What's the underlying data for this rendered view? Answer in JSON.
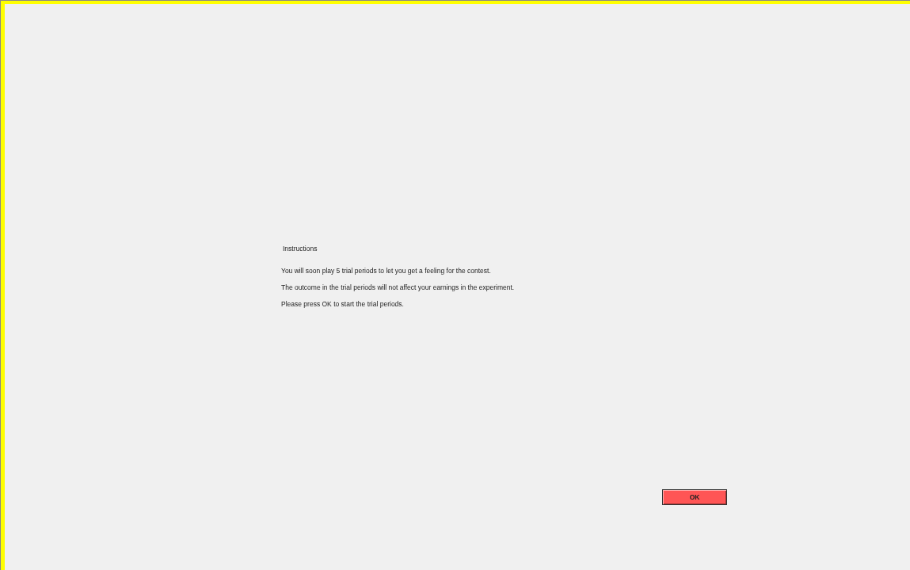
{
  "title": "Instructions",
  "paragraphs": [
    "You will soon play 5 trial periods to let you get a feeling for the contest.",
    "The outcome in the trial periods will not affect your earnings in the experiment.",
    "Please press OK to start the trial periods."
  ],
  "button": {
    "label": "OK"
  }
}
